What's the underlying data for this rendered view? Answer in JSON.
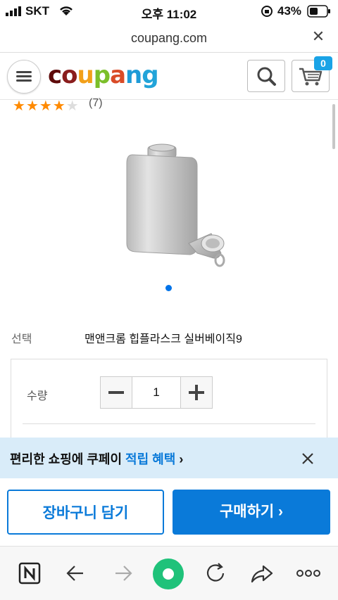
{
  "status_bar": {
    "carrier": "SKT",
    "time": "오후 11:02",
    "battery": "43%"
  },
  "browser": {
    "url": "coupang.com",
    "close_glyph": "✕"
  },
  "header": {
    "logo_letters": [
      "c",
      "o",
      "u",
      "p",
      "a",
      "n",
      "g"
    ],
    "logo_colors": [
      "#5e0a0a",
      "#8a1d1d",
      "#f2a01a",
      "#7bbf2a",
      "#d94b27",
      "#1e9bd7",
      "#22a4d9"
    ],
    "cart_count": "0"
  },
  "product": {
    "rating_stars_filled": 4,
    "rating_stars_total": 5,
    "review_count": "(7)",
    "image_count": 1,
    "option_label": "선택",
    "option_value": "맨앤크롬 힙플라스크 실버베이직9"
  },
  "quantity": {
    "label": "수량",
    "value": "1"
  },
  "banner": {
    "text_prefix": "편리한 쇼핑에 쿠페이 ",
    "text_highlight": "적립 혜택",
    "arrow": "›"
  },
  "actions": {
    "add_to_cart": "장바구니 담기",
    "buy_now": "구매하기 ›"
  },
  "colors": {
    "accent": "#0a7ad9",
    "banner_bg": "#d9ecf9",
    "star": "#ff8a00",
    "toolbar_green": "#1fc27a"
  },
  "toolbar_icons": [
    "naver-n-icon",
    "back-arrow-icon",
    "forward-arrow-icon",
    "green-dot-icon",
    "refresh-icon",
    "share-icon",
    "more-icon"
  ]
}
